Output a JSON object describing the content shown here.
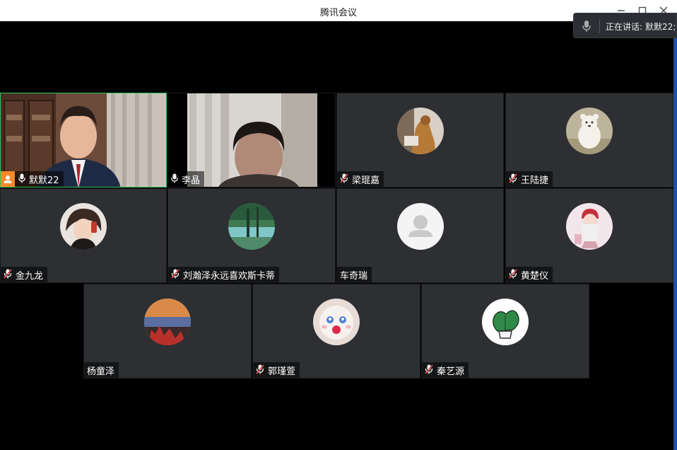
{
  "window": {
    "title": "腾讯会议",
    "min_icon": "minimize-icon",
    "max_icon": "maximize-icon",
    "close_icon": "close-icon"
  },
  "speaking": {
    "label": "正在讲话:",
    "names": "默默22;"
  },
  "participants": [
    {
      "name": "默默22",
      "mic": "on",
      "host": true,
      "kind": "video-host"
    },
    {
      "name": "李晶",
      "mic": "on",
      "host": false,
      "kind": "video"
    },
    {
      "name": "梁琨嘉",
      "mic": "muted",
      "host": false,
      "kind": "avatar"
    },
    {
      "name": "王陆捷",
      "mic": "muted",
      "host": false,
      "kind": "avatar"
    },
    {
      "name": "金九龙",
      "mic": "muted",
      "host": false,
      "kind": "avatar"
    },
    {
      "name": "刘瀚泽永远喜欢斯卡蒂",
      "mic": "muted",
      "host": false,
      "kind": "avatar"
    },
    {
      "name": "车奇瑞",
      "mic": "none",
      "host": false,
      "kind": "avatar-default"
    },
    {
      "name": "黄楚仪",
      "mic": "muted",
      "host": false,
      "kind": "avatar"
    },
    {
      "name": "杨童泽",
      "mic": "none",
      "host": false,
      "kind": "avatar"
    },
    {
      "name": "郭瑾萱",
      "mic": "muted",
      "host": false,
      "kind": "avatar"
    },
    {
      "name": "秦艺源",
      "mic": "muted",
      "host": false,
      "kind": "avatar"
    }
  ],
  "colors": {
    "muted": "#e04545",
    "host": "#f28a2b",
    "speaking_border": "#2fc25f"
  }
}
